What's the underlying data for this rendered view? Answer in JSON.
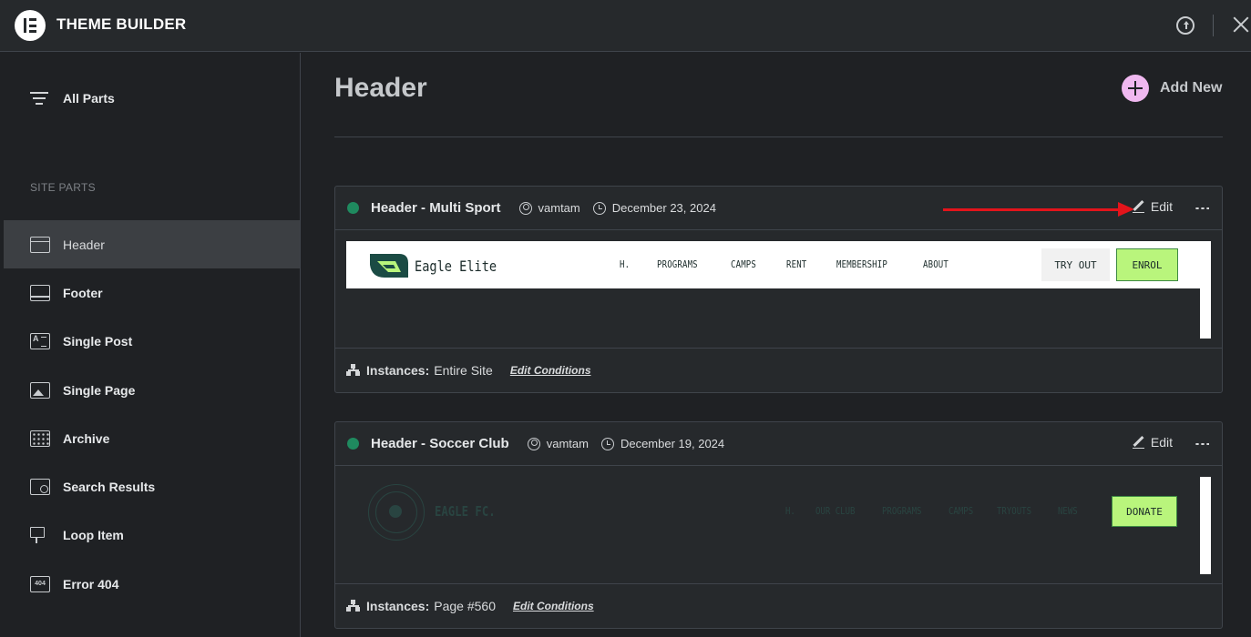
{
  "app": {
    "title": "THEME BUILDER"
  },
  "sidebar": {
    "all_parts_label": "All Parts",
    "section_label": "SITE PARTS",
    "items": [
      {
        "label": "Header",
        "icon": "header-layout-icon",
        "active": true
      },
      {
        "label": "Footer",
        "icon": "footer-layout-icon"
      },
      {
        "label": "Single Post",
        "icon": "single-post-icon"
      },
      {
        "label": "Single Page",
        "icon": "single-page-icon"
      },
      {
        "label": "Archive",
        "icon": "archive-grid-icon"
      },
      {
        "label": "Search Results",
        "icon": "search-results-icon"
      },
      {
        "label": "Loop Item",
        "icon": "loop-item-icon"
      },
      {
        "label": "Error 404",
        "icon": "error-404-icon",
        "icon_text": "404"
      }
    ]
  },
  "main": {
    "title": "Header",
    "add_new_label": "Add New",
    "templates": [
      {
        "title": "Header - Multi Sport",
        "author": "vamtam",
        "date": "December 23, 2024",
        "edit_label": "Edit",
        "instances_label": "Instances:",
        "instances_value": "Entire Site",
        "edit_conditions_label": "Edit Conditions",
        "preview": {
          "brand": "Eagle Elite",
          "nav": [
            "H.",
            "PROGRAMS",
            "CAMPS",
            "RENT",
            "MEMBERSHIP",
            "ABOUT"
          ],
          "secondary_button": "TRY OUT",
          "primary_button": "ENROL"
        }
      },
      {
        "title": "Header - Soccer Club",
        "author": "vamtam",
        "date": "December 19, 2024",
        "edit_label": "Edit",
        "instances_label": "Instances:",
        "instances_value": "Page #560",
        "edit_conditions_label": "Edit Conditions",
        "preview": {
          "brand": "EAGLE FC.",
          "nav": [
            "H.",
            "OUR CLUB",
            "PROGRAMS",
            "CAMPS",
            "TRYOUTS",
            "NEWS"
          ],
          "primary_button": "DONATE"
        }
      }
    ]
  },
  "colors": {
    "background": "#1f2124",
    "panel": "#26292c",
    "status_published": "#1f8a5f",
    "add_new_accent": "#f0b8f0",
    "annotation_arrow": "#e3141b",
    "preview_cta": "#b9f57c"
  }
}
